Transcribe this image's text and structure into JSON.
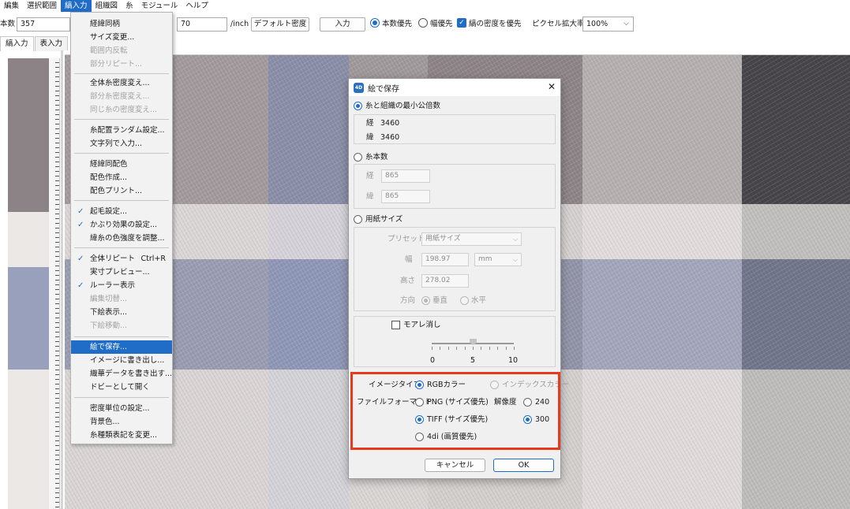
{
  "menubar": {
    "items": [
      "編集",
      "選択範囲",
      "縞入力",
      "組織図",
      "糸",
      "モジュール",
      "ヘルプ"
    ],
    "active_index": 2
  },
  "toolbar": {
    "count_label": "本数",
    "count_value": "357",
    "density_value": "70",
    "density_unit": "/inch",
    "default_density_button": "デフォルト密度",
    "input_button": "入力",
    "count_priority": "本数優先",
    "width_priority": "幅優先",
    "stripe_density_priority": "縞の密度を優先",
    "pixel_zoom_label": "ピクセル拡大率",
    "pixel_zoom_value": "100%"
  },
  "tabs": [
    "縞入力",
    "表入力"
  ],
  "dropdown": {
    "items": [
      {
        "label": "経緯同柄",
        "state": "normal"
      },
      {
        "label": "サイズ変更...",
        "state": "normal"
      },
      {
        "label": "範囲内反転",
        "state": "disabled"
      },
      {
        "label": "部分リピート...",
        "state": "disabled"
      },
      {
        "label": "全体糸密度変え...",
        "state": "normal"
      },
      {
        "label": "部分糸密度変え...",
        "state": "disabled"
      },
      {
        "label": "同じ糸の密度変え...",
        "state": "disabled"
      },
      {
        "label": "糸配置ランダム設定...",
        "state": "normal"
      },
      {
        "label": "文字列で入力...",
        "state": "normal"
      },
      {
        "label": "経緯同配色",
        "state": "normal"
      },
      {
        "label": "配色作成...",
        "state": "normal"
      },
      {
        "label": "配色プリント...",
        "state": "normal"
      },
      {
        "label": "起毛設定...",
        "state": "checked"
      },
      {
        "label": "かぶり効果の設定...",
        "state": "checked"
      },
      {
        "label": "緯糸の色強度を調整...",
        "state": "normal"
      },
      {
        "label": "全体リピート",
        "state": "checked",
        "shortcut": "Ctrl+R"
      },
      {
        "label": "実寸プレビュー...",
        "state": "normal"
      },
      {
        "label": "ルーラー表示",
        "state": "checked"
      },
      {
        "label": "編集切替...",
        "state": "disabled"
      },
      {
        "label": "下絵表示...",
        "state": "normal"
      },
      {
        "label": "下絵移動...",
        "state": "disabled"
      },
      {
        "label": "絵で保存...",
        "state": "highlighted"
      },
      {
        "label": "イメージに書き出し...",
        "state": "normal"
      },
      {
        "label": "織華データを書き出す...",
        "state": "normal"
      },
      {
        "label": "ドビーとして開く",
        "state": "normal"
      },
      {
        "label": "密度単位の設定...",
        "state": "normal"
      },
      {
        "label": "背景色...",
        "state": "normal"
      },
      {
        "label": "糸種類表記を変更...",
        "state": "normal"
      }
    ]
  },
  "dialog": {
    "logo": "4D",
    "title": "絵で保存",
    "close": "✕",
    "option_lcm": "糸と組織の最小公倍数",
    "warp_label": "経",
    "warp_value": "3460",
    "weft_label": "緯",
    "weft_value": "3460",
    "option_thread_count": "糸本数",
    "tc_warp_label": "経",
    "tc_warp_value": "865",
    "tc_weft_label": "緯",
    "tc_weft_value": "865",
    "option_paper_size": "用紙サイズ",
    "preset_label": "プリセット",
    "preset_value": "用紙サイズ",
    "width_label": "幅",
    "width_value": "198.97",
    "unit_value": "mm",
    "height_label": "高さ",
    "height_value": "278.02",
    "orientation_label": "方向",
    "orientation_vertical": "垂直",
    "orientation_horizontal": "水平",
    "moire_label": "モアレ消し",
    "slider_min": "0",
    "slider_mid": "5",
    "slider_max": "10",
    "slider_value": 5,
    "image_type_label": "イメージタイプ",
    "rgb_color": "RGBカラー",
    "indexed_color": "インデックスカラー",
    "file_format_label": "ファイルフォーマット",
    "png_option": "PNG (サイズ優先)",
    "tiff_option": "TIFF (サイズ優先)",
    "fourdi_option": "4di (画質優先)",
    "resolution_label": "解像度",
    "res_240": "240",
    "res_300": "300",
    "cancel_button": "キャンセル",
    "ok_button": "OK"
  },
  "colors": {
    "accent": "#1f6dc6",
    "highlight_box": "#e53a1e",
    "fabric_gray": "#8f8588",
    "fabric_blue": "#9ea6c0",
    "fabric_dark": "#3c3a3d"
  }
}
